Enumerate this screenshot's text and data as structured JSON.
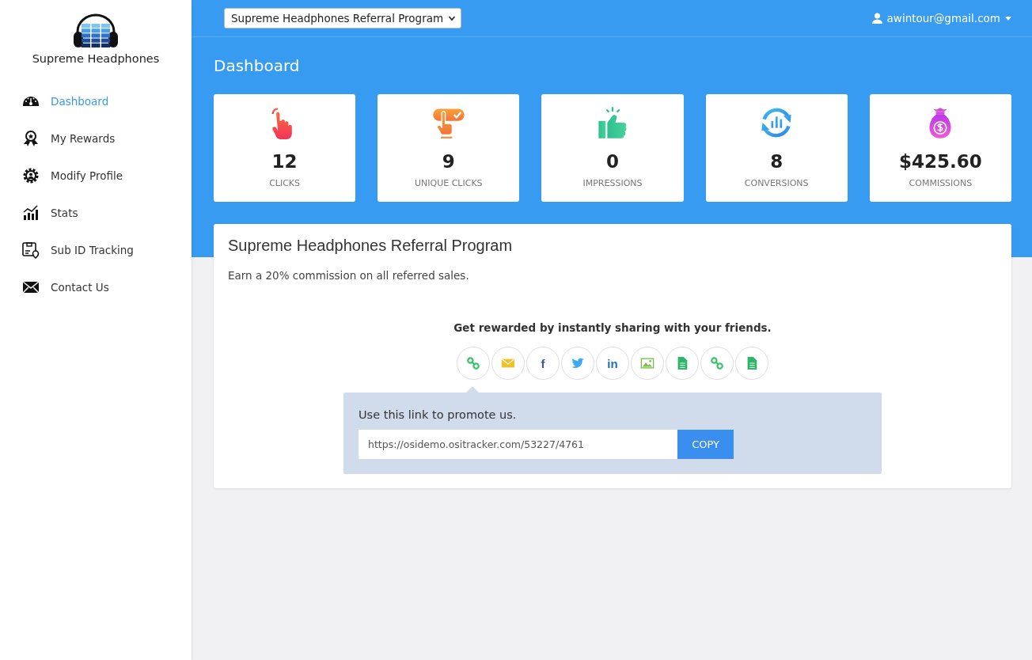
{
  "sidebar": {
    "brand": "Supreme Headphones",
    "items": [
      {
        "label": "Dashboard",
        "selected": true
      },
      {
        "label": "My Rewards",
        "selected": false
      },
      {
        "label": "Modify Profile",
        "selected": false
      },
      {
        "label": "Stats",
        "selected": false
      },
      {
        "label": "Sub ID Tracking",
        "selected": false
      },
      {
        "label": "Contact Us",
        "selected": false
      }
    ]
  },
  "topbar": {
    "program_select": "Supreme Headphones Referral Program",
    "user": "awintour@gmail.com"
  },
  "page_title": "Dashboard",
  "stats": [
    {
      "value": "12",
      "label": "CLICKS"
    },
    {
      "value": "9",
      "label": "UNIQUE CLICKS"
    },
    {
      "value": "0",
      "label": "IMPRESSIONS"
    },
    {
      "value": "8",
      "label": "CONVERSIONS"
    },
    {
      "value": "$425.60",
      "label": "COMMISSIONS"
    }
  ],
  "program": {
    "title": "Supreme Headphones Referral Program",
    "description": "Earn a 20% commission on all referred sales.",
    "share_heading": "Get rewarded by instantly sharing with your friends.",
    "share_buttons": [
      {
        "kind": "link"
      },
      {
        "kind": "email"
      },
      {
        "kind": "facebook",
        "glyph": "f"
      },
      {
        "kind": "twitter"
      },
      {
        "kind": "linkedin",
        "glyph": "in"
      },
      {
        "kind": "image"
      },
      {
        "kind": "document"
      },
      {
        "kind": "link"
      },
      {
        "kind": "document"
      }
    ],
    "promo": {
      "label": "Use this link to promote us.",
      "url": "https://osidemo.ositracker.com/53227/4761",
      "button": "COPY"
    }
  }
}
